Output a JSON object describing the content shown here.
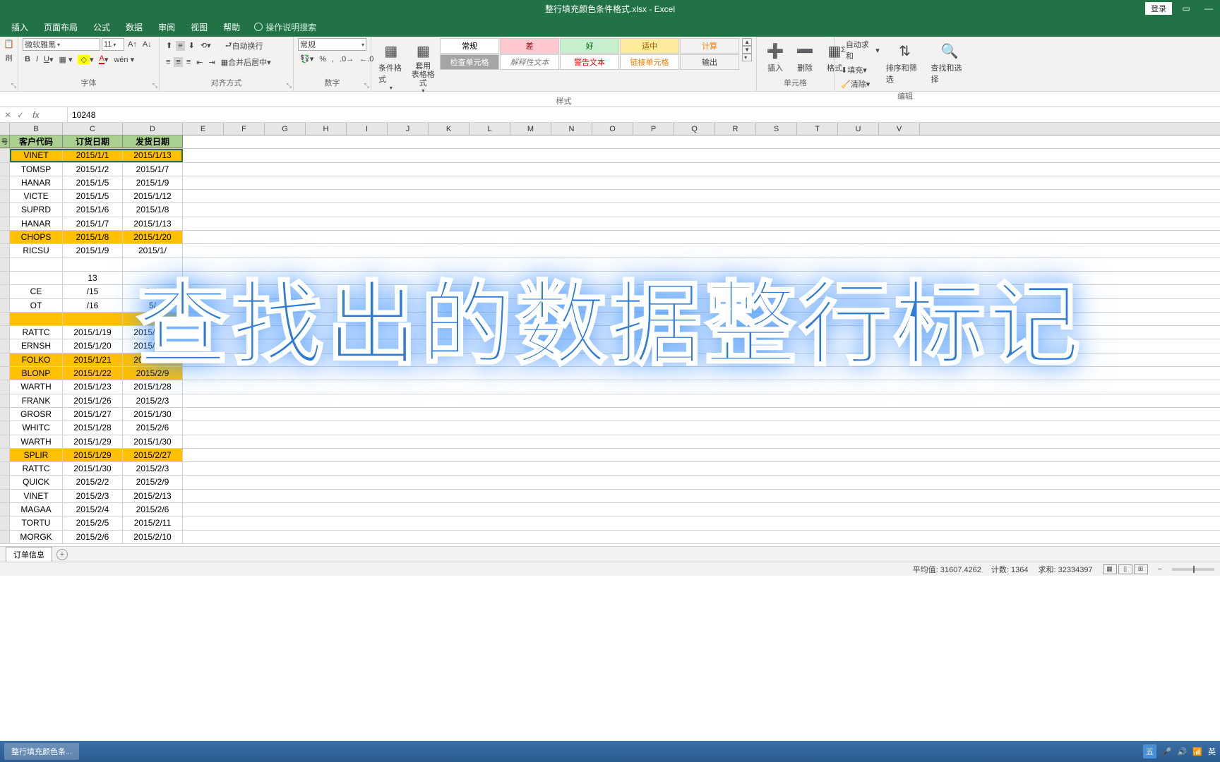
{
  "title": "整行填充颜色条件格式.xlsx  -  Excel",
  "login": "登录",
  "tabs": [
    "插入",
    "页面布局",
    "公式",
    "数据",
    "审阅",
    "视图",
    "帮助"
  ],
  "tell_me": "操作说明搜索",
  "font": {
    "name": "微软雅黑",
    "size": "11",
    "group": "字体"
  },
  "align": {
    "wrap": "自动换行",
    "merge": "合并后居中",
    "group": "对齐方式"
  },
  "number": {
    "format": "常规",
    "group": "数字"
  },
  "styles": {
    "cond": "条件格式",
    "table": "套用\n表格格式",
    "gallery": [
      {
        "t": "常规",
        "bg": "#fff",
        "c": "#000"
      },
      {
        "t": "差",
        "bg": "#ffc7ce",
        "c": "#9c0006"
      },
      {
        "t": "好",
        "bg": "#c6efce",
        "c": "#006100"
      },
      {
        "t": "适中",
        "bg": "#ffeb9c",
        "c": "#9c5700"
      },
      {
        "t": "计算",
        "bg": "#f2f2f2",
        "c": "#fa7d00"
      },
      {
        "t": "检查单元格",
        "bg": "#a5a5a5",
        "c": "#fff"
      },
      {
        "t": "解释性文本",
        "bg": "#fff",
        "c": "#7f7f7f"
      },
      {
        "t": "警告文本",
        "bg": "#fff",
        "c": "#ff0000"
      },
      {
        "t": "链接单元格",
        "bg": "#fff",
        "c": "#fa7d00"
      },
      {
        "t": "输出",
        "bg": "#f2f2f2",
        "c": "#3f3f3f"
      }
    ],
    "group": "样式"
  },
  "cells": {
    "insert": "插入",
    "delete": "删除",
    "format": "格式",
    "group": "单元格"
  },
  "editing": {
    "sum": "自动求和",
    "fill": "填充",
    "clear": "清除",
    "sort": "排序和筛选",
    "find": "查找和选择",
    "group": "编辑"
  },
  "namebox": "",
  "formula": "10248",
  "cols": [
    "号",
    "客户代码",
    "订货日期",
    "发货日期"
  ],
  "extra_cols": [
    "E",
    "F",
    "G",
    "H",
    "I",
    "J",
    "K",
    "L",
    "M",
    "N",
    "O",
    "P",
    "Q",
    "R",
    "S",
    "T",
    "U",
    "V"
  ],
  "rows": [
    {
      "b": "VINET",
      "c": "2015/1/1",
      "d": "2015/1/13",
      "hl": true
    },
    {
      "b": "TOMSP",
      "c": "2015/1/2",
      "d": "2015/1/7"
    },
    {
      "b": "HANAR",
      "c": "2015/1/5",
      "d": "2015/1/9"
    },
    {
      "b": "VICTE",
      "c": "2015/1/5",
      "d": "2015/1/12"
    },
    {
      "b": "SUPRD",
      "c": "2015/1/6",
      "d": "2015/1/8"
    },
    {
      "b": "HANAR",
      "c": "2015/1/7",
      "d": "2015/1/13"
    },
    {
      "b": "CHOPS",
      "c": "2015/1/8",
      "d": "2015/1/20",
      "hl": true
    },
    {
      "b": "RICSU",
      "c": "2015/1/9",
      "d": "2015/1/"
    },
    {
      "b": "",
      "c": "",
      "d": ""
    },
    {
      "b": "",
      "c": "13",
      "d": ""
    },
    {
      "b": "CE",
      "c": "/15",
      "d": "5/1/"
    },
    {
      "b": "OT",
      "c": "/16",
      "d": "5/"
    },
    {
      "b": "",
      "c": "",
      "d": "",
      "hl": true
    },
    {
      "b": "RATTC",
      "c": "2015/1/19",
      "d": "2015/1/22"
    },
    {
      "b": "ERNSH",
      "c": "2015/1/20",
      "d": "2015/1/28"
    },
    {
      "b": "FOLKO",
      "c": "2015/1/21",
      "d": "2015/2/20",
      "hl": true
    },
    {
      "b": "BLONP",
      "c": "2015/1/22",
      "d": "2015/2/9",
      "hl": true
    },
    {
      "b": "WARTH",
      "c": "2015/1/23",
      "d": "2015/1/28"
    },
    {
      "b": "FRANK",
      "c": "2015/1/26",
      "d": "2015/2/3"
    },
    {
      "b": "GROSR",
      "c": "2015/1/27",
      "d": "2015/1/30"
    },
    {
      "b": "WHITC",
      "c": "2015/1/28",
      "d": "2015/2/6"
    },
    {
      "b": "WARTH",
      "c": "2015/1/29",
      "d": "2015/1/30"
    },
    {
      "b": "SPLIR",
      "c": "2015/1/29",
      "d": "2015/2/27",
      "hl": true
    },
    {
      "b": "RATTC",
      "c": "2015/1/30",
      "d": "2015/2/3"
    },
    {
      "b": "QUICK",
      "c": "2015/2/2",
      "d": "2015/2/9"
    },
    {
      "b": "VINET",
      "c": "2015/2/3",
      "d": "2015/2/13"
    },
    {
      "b": "MAGAA",
      "c": "2015/2/4",
      "d": "2015/2/6"
    },
    {
      "b": "TORTU",
      "c": "2015/2/5",
      "d": "2015/2/11"
    },
    {
      "b": "MORGK",
      "c": "2015/2/6",
      "d": "2015/2/10"
    }
  ],
  "overlay": "查找出的数据整行标记",
  "sheet": "订单信息",
  "status": {
    "avg_l": "平均值:",
    "avg": "31607.4262",
    "cnt_l": "计数:",
    "cnt": "1364",
    "sum_l": "求和:",
    "sum": "32334397"
  },
  "taskbar": "整行填充颜色条...",
  "tray": {
    "ime": "五",
    "lang": "英"
  }
}
